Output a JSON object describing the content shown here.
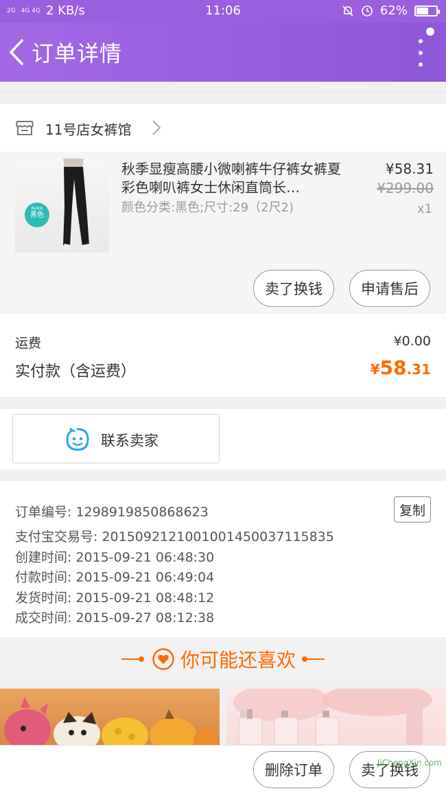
{
  "status_bar": {
    "signal_1": "2G",
    "signal_2": "4G 4G",
    "speed": "2 KB/s",
    "time": "11:06",
    "battery": "62%",
    "battery_level": 0.62
  },
  "header": {
    "title": "订单详情"
  },
  "shop": {
    "name": "11号店女裤馆"
  },
  "product": {
    "title": "秋季显瘦高腰小微喇裤牛仔裤女裤夏彩色喇叭裤女士休闲直筒长…",
    "spec": "颜色分类:黑色;尺寸:29（2尺2)",
    "price": "¥58.31",
    "original_price": "¥299.00",
    "quantity": "x1",
    "badge_small": "BLACK",
    "badge_label": "黑色",
    "actions": [
      "卖了换钱",
      "申请售后"
    ]
  },
  "fees": {
    "shipping_label": "运费",
    "shipping_value": "¥0.00",
    "total_label": "实付款（含运费）",
    "total_currency": "¥",
    "total_int": "58",
    "total_dec": ".31"
  },
  "contact": {
    "label": "联系卖家"
  },
  "order_info": {
    "copy_label": "复制",
    "rows": [
      "订单编号: 1298919850868623",
      "支付宝交易号: 2015092121001001450037115835",
      "创建时间: 2015-09-21 06:48:30",
      "付款时间: 2015-09-21 06:49:04",
      "发货时间: 2015-09-21 08:48:12",
      "成交时间: 2015-09-27 08:12:38"
    ]
  },
  "recommend": {
    "title": "你可能还喜欢"
  },
  "bottom_bar": {
    "actions": [
      "删除订单",
      "卖了换钱"
    ]
  },
  "watermark": "JiChengXin.com",
  "colors": {
    "header": "#9a5fde",
    "accent": "#ff6a00",
    "contact_icon": "#29a6e6"
  }
}
